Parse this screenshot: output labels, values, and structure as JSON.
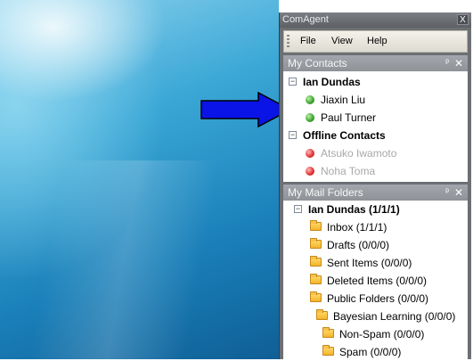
{
  "window": {
    "title": "ComAgent",
    "close": "X"
  },
  "menu": {
    "file": "File",
    "view": "View",
    "help": "Help"
  },
  "contacts": {
    "header": "My Contacts",
    "pin": "ᵖ",
    "close": "✕",
    "groups": [
      {
        "name": "Ian Dundas",
        "expander": "−",
        "members": [
          "Jiaxin Liu",
          "Paul Turner"
        ]
      },
      {
        "name": "Offline Contacts",
        "expander": "−",
        "members": [
          "Atsuko Iwamoto",
          "Noha Toma"
        ]
      }
    ]
  },
  "mail": {
    "header": "My Mail Folders",
    "pin": "ᵖ",
    "close": "✕",
    "root": {
      "name": "Ian Dundas (1/1/1)",
      "expander": "−"
    },
    "folders": [
      "Inbox (1/1/1)",
      "Drafts (0/0/0)",
      "Sent Items (0/0/0)",
      "Deleted Items (0/0/0)",
      "Public Folders (0/0/0)",
      "Bayesian Learning (0/0/0)",
      "Non-Spam (0/0/0)",
      "Spam (0/0/0)"
    ]
  },
  "colors": {
    "arrow": "#0a14e6",
    "online": "#3aa12c",
    "offline": "#e03030"
  }
}
